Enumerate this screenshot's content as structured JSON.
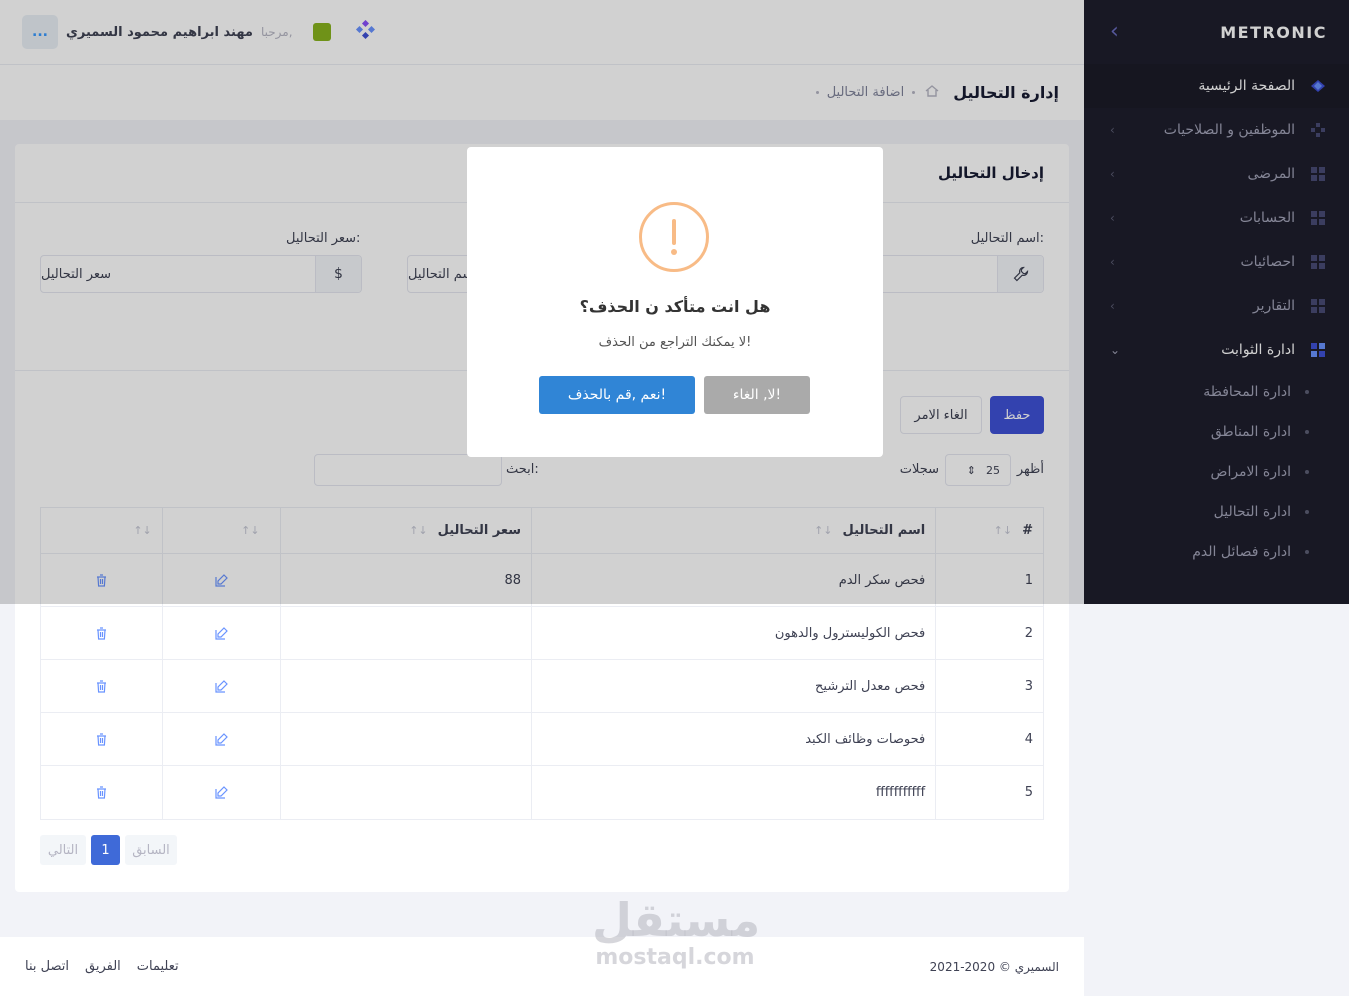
{
  "sidebar": {
    "brand": "METRONIC",
    "items": [
      {
        "label": "الصفحة الرئيسية"
      },
      {
        "label": "الموظفين و الصلاحيات"
      },
      {
        "label": "المرضى"
      },
      {
        "label": "الحسابات"
      },
      {
        "label": "احصائيات"
      },
      {
        "label": "التقارير"
      },
      {
        "label": "ادارة الثوابت"
      }
    ],
    "sub_items": [
      {
        "label": "ادارة المحافظة"
      },
      {
        "label": "ادارة المناطق"
      },
      {
        "label": "ادارة الامراض"
      },
      {
        "label": "ادارة التحاليل"
      },
      {
        "label": "ادارة فصائل الدم"
      }
    ]
  },
  "header": {
    "menu_button": "...",
    "welcome": "مرحبا,",
    "user_name": "مهند ابراهيم محمود السميري"
  },
  "subheader": {
    "title": "إدارة التحاليل",
    "breadcrumb": "اضافة التحاليل"
  },
  "card": {
    "title": "إدخال التحاليل",
    "name_label": "اسم التحاليل:",
    "name_placeholder": "اسم التحاليل",
    "price_label": "سعر التحاليل:",
    "price_placeholder": "سعر التحاليل",
    "price_addon": "$",
    "save_label": "حفظ",
    "cancel_label": "الغاء الامر",
    "show_label": "أظهر",
    "page_length": "25",
    "records_label": "سجلات",
    "search_label": "ابحث:"
  },
  "table": {
    "columns": [
      "#",
      "اسم التحاليل",
      "سعر التحاليل",
      "",
      ""
    ],
    "rows": [
      {
        "num": "1",
        "name": "فحص سكر الدم",
        "price": "88"
      },
      {
        "num": "2",
        "name": "فحص الكوليسترول والدهون",
        "price": ""
      },
      {
        "num": "3",
        "name": "فحص معدل الترشيح",
        "price": ""
      },
      {
        "num": "4",
        "name": "فحوصات وظائف الكبد",
        "price": ""
      },
      {
        "num": "5",
        "name": "fffffffffff",
        "price": ""
      }
    ]
  },
  "pagination": {
    "previous": "السابق",
    "current": "1",
    "next": "التالي"
  },
  "footer": {
    "copyright": "2021-2020 © السميري",
    "links": [
      "تعليمات",
      "الفريق",
      "اتصل بنا"
    ]
  },
  "modal": {
    "icon": "!",
    "title": "هل انت متأكد ن الحذف؟",
    "text": "لا يمكنك التراجع من الحذف!",
    "confirm_label": "نعم ,قم بالحذف!",
    "cancel_label": "لا, الغاء!"
  },
  "watermark": {
    "arabic": "مستقل",
    "latin": "mostaql.com"
  },
  "colors": {
    "sidebar_bg": "#1e1e2d",
    "primary": "#3f51d6",
    "modal_confirm": "#3085d6",
    "modal_cancel": "#aaaaaa",
    "warning": "#f8bb86"
  }
}
